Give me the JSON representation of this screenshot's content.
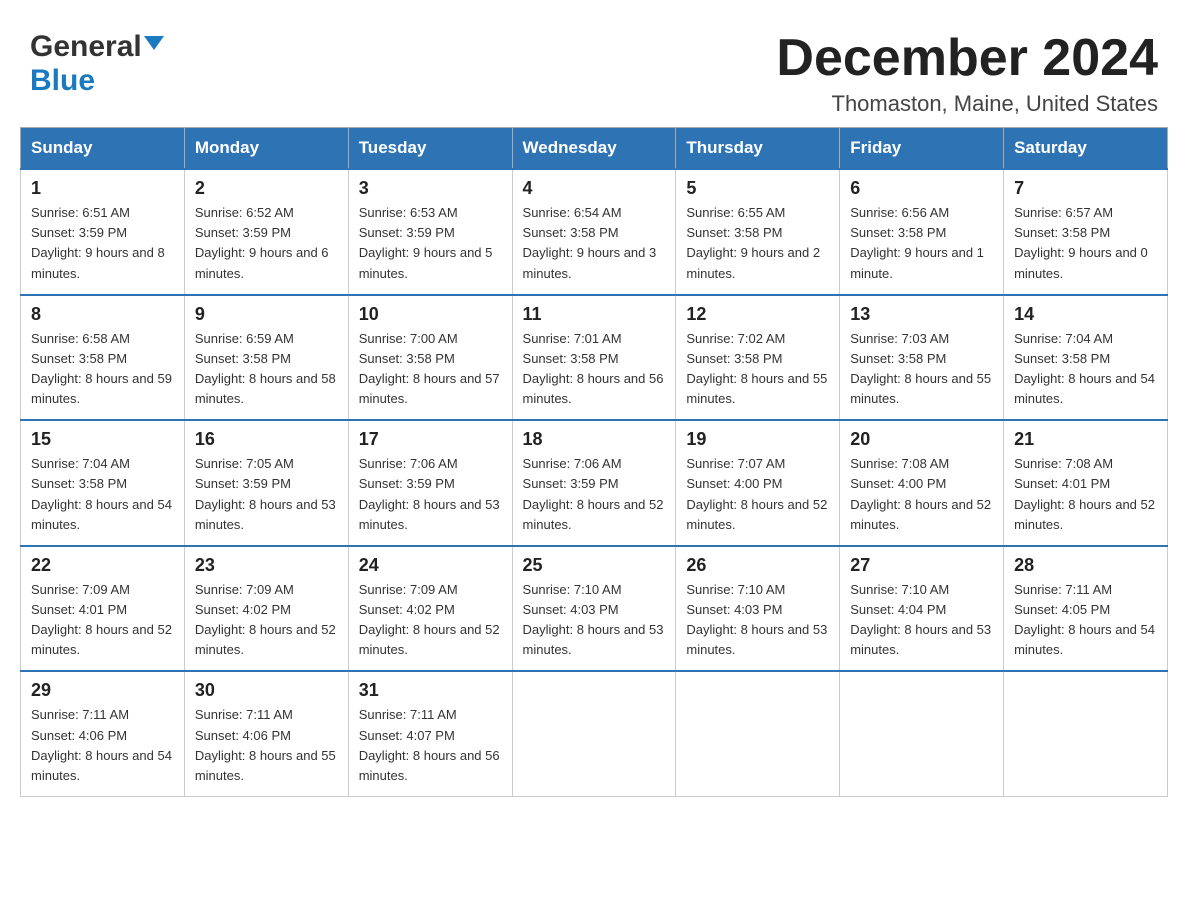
{
  "header": {
    "logo_general": "General",
    "logo_blue": "Blue",
    "month_title": "December 2024",
    "location": "Thomaston, Maine, United States"
  },
  "days_of_week": [
    "Sunday",
    "Monday",
    "Tuesday",
    "Wednesday",
    "Thursday",
    "Friday",
    "Saturday"
  ],
  "weeks": [
    [
      {
        "day": "1",
        "sunrise": "6:51 AM",
        "sunset": "3:59 PM",
        "daylight": "9 hours and 8 minutes."
      },
      {
        "day": "2",
        "sunrise": "6:52 AM",
        "sunset": "3:59 PM",
        "daylight": "9 hours and 6 minutes."
      },
      {
        "day": "3",
        "sunrise": "6:53 AM",
        "sunset": "3:59 PM",
        "daylight": "9 hours and 5 minutes."
      },
      {
        "day": "4",
        "sunrise": "6:54 AM",
        "sunset": "3:58 PM",
        "daylight": "9 hours and 3 minutes."
      },
      {
        "day": "5",
        "sunrise": "6:55 AM",
        "sunset": "3:58 PM",
        "daylight": "9 hours and 2 minutes."
      },
      {
        "day": "6",
        "sunrise": "6:56 AM",
        "sunset": "3:58 PM",
        "daylight": "9 hours and 1 minute."
      },
      {
        "day": "7",
        "sunrise": "6:57 AM",
        "sunset": "3:58 PM",
        "daylight": "9 hours and 0 minutes."
      }
    ],
    [
      {
        "day": "8",
        "sunrise": "6:58 AM",
        "sunset": "3:58 PM",
        "daylight": "8 hours and 59 minutes."
      },
      {
        "day": "9",
        "sunrise": "6:59 AM",
        "sunset": "3:58 PM",
        "daylight": "8 hours and 58 minutes."
      },
      {
        "day": "10",
        "sunrise": "7:00 AM",
        "sunset": "3:58 PM",
        "daylight": "8 hours and 57 minutes."
      },
      {
        "day": "11",
        "sunrise": "7:01 AM",
        "sunset": "3:58 PM",
        "daylight": "8 hours and 56 minutes."
      },
      {
        "day": "12",
        "sunrise": "7:02 AM",
        "sunset": "3:58 PM",
        "daylight": "8 hours and 55 minutes."
      },
      {
        "day": "13",
        "sunrise": "7:03 AM",
        "sunset": "3:58 PM",
        "daylight": "8 hours and 55 minutes."
      },
      {
        "day": "14",
        "sunrise": "7:04 AM",
        "sunset": "3:58 PM",
        "daylight": "8 hours and 54 minutes."
      }
    ],
    [
      {
        "day": "15",
        "sunrise": "7:04 AM",
        "sunset": "3:58 PM",
        "daylight": "8 hours and 54 minutes."
      },
      {
        "day": "16",
        "sunrise": "7:05 AM",
        "sunset": "3:59 PM",
        "daylight": "8 hours and 53 minutes."
      },
      {
        "day": "17",
        "sunrise": "7:06 AM",
        "sunset": "3:59 PM",
        "daylight": "8 hours and 53 minutes."
      },
      {
        "day": "18",
        "sunrise": "7:06 AM",
        "sunset": "3:59 PM",
        "daylight": "8 hours and 52 minutes."
      },
      {
        "day": "19",
        "sunrise": "7:07 AM",
        "sunset": "4:00 PM",
        "daylight": "8 hours and 52 minutes."
      },
      {
        "day": "20",
        "sunrise": "7:08 AM",
        "sunset": "4:00 PM",
        "daylight": "8 hours and 52 minutes."
      },
      {
        "day": "21",
        "sunrise": "7:08 AM",
        "sunset": "4:01 PM",
        "daylight": "8 hours and 52 minutes."
      }
    ],
    [
      {
        "day": "22",
        "sunrise": "7:09 AM",
        "sunset": "4:01 PM",
        "daylight": "8 hours and 52 minutes."
      },
      {
        "day": "23",
        "sunrise": "7:09 AM",
        "sunset": "4:02 PM",
        "daylight": "8 hours and 52 minutes."
      },
      {
        "day": "24",
        "sunrise": "7:09 AM",
        "sunset": "4:02 PM",
        "daylight": "8 hours and 52 minutes."
      },
      {
        "day": "25",
        "sunrise": "7:10 AM",
        "sunset": "4:03 PM",
        "daylight": "8 hours and 53 minutes."
      },
      {
        "day": "26",
        "sunrise": "7:10 AM",
        "sunset": "4:03 PM",
        "daylight": "8 hours and 53 minutes."
      },
      {
        "day": "27",
        "sunrise": "7:10 AM",
        "sunset": "4:04 PM",
        "daylight": "8 hours and 53 minutes."
      },
      {
        "day": "28",
        "sunrise": "7:11 AM",
        "sunset": "4:05 PM",
        "daylight": "8 hours and 54 minutes."
      }
    ],
    [
      {
        "day": "29",
        "sunrise": "7:11 AM",
        "sunset": "4:06 PM",
        "daylight": "8 hours and 54 minutes."
      },
      {
        "day": "30",
        "sunrise": "7:11 AM",
        "sunset": "4:06 PM",
        "daylight": "8 hours and 55 minutes."
      },
      {
        "day": "31",
        "sunrise": "7:11 AM",
        "sunset": "4:07 PM",
        "daylight": "8 hours and 56 minutes."
      },
      null,
      null,
      null,
      null
    ]
  ],
  "labels": {
    "sunrise": "Sunrise:",
    "sunset": "Sunset:",
    "daylight": "Daylight:"
  }
}
